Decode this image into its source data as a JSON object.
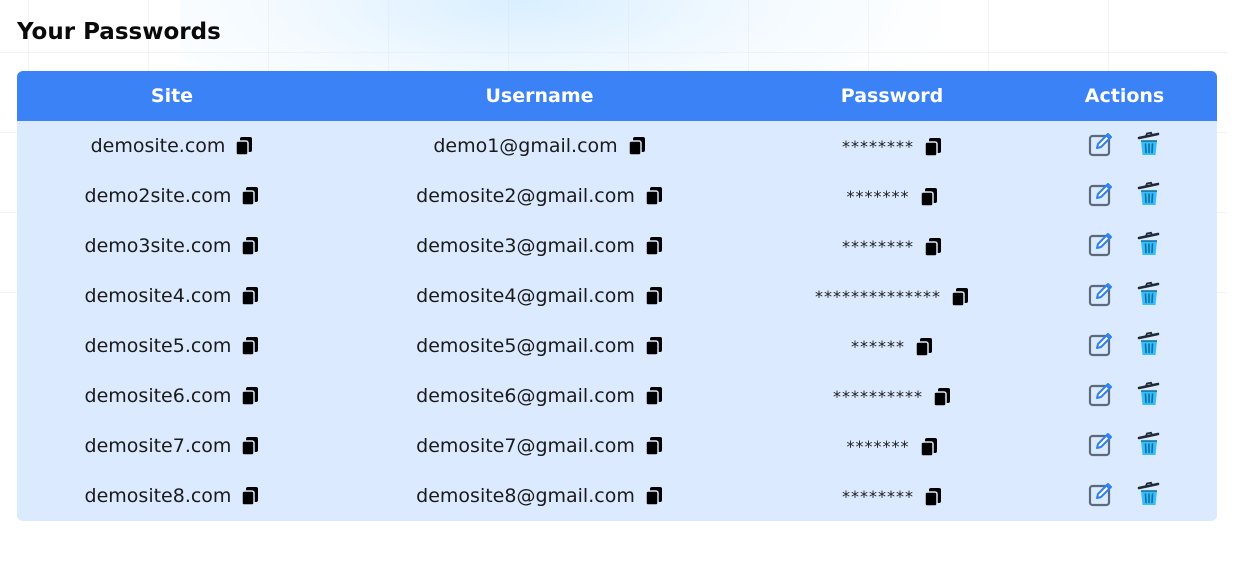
{
  "title": "Your Passwords",
  "columns": {
    "site": "Site",
    "username": "Username",
    "password": "Password",
    "actions": "Actions"
  },
  "rows": [
    {
      "site": "demosite.com",
      "username": "demo1@gmail.com",
      "password": "********"
    },
    {
      "site": "demo2site.com",
      "username": "demosite2@gmail.com",
      "password": "*******"
    },
    {
      "site": "demo3site.com",
      "username": "demosite3@gmail.com",
      "password": "********"
    },
    {
      "site": "demosite4.com",
      "username": "demosite4@gmail.com",
      "password": "**************"
    },
    {
      "site": "demosite5.com",
      "username": "demosite5@gmail.com",
      "password": "******"
    },
    {
      "site": "demosite6.com",
      "username": "demosite6@gmail.com",
      "password": "**********"
    },
    {
      "site": "demosite7.com",
      "username": "demosite7@gmail.com",
      "password": "*******"
    },
    {
      "site": "demosite8.com",
      "username": "demosite8@gmail.com",
      "password": "********"
    }
  ],
  "icons": {
    "copy": "copy-icon",
    "edit": "edit-icon",
    "delete": "trash-icon"
  },
  "colors": {
    "header_bg": "#3b82f6",
    "body_bg": "#dbeafe",
    "header_text": "#ffffff",
    "edit_icon": "#4a7bb7",
    "delete_icon": "#38bdf8"
  }
}
